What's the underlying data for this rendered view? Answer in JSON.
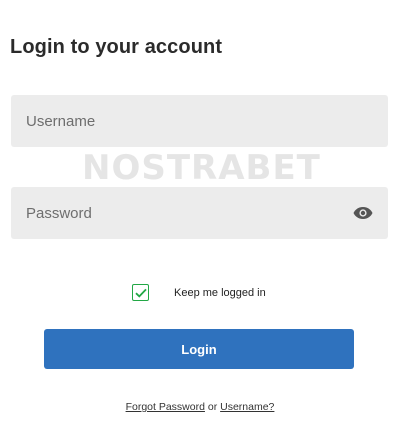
{
  "header": {
    "title": "Login to your account"
  },
  "form": {
    "username_placeholder": "Username",
    "password_placeholder": "Password",
    "password_toggle_icon": "eye-icon",
    "remember_me_label": "Keep me logged in",
    "remember_me_checked": true,
    "login_button_label": "Login"
  },
  "footer": {
    "forgot_password_link": "Forgot Password",
    "or_text": " or ",
    "username_link": "Username?"
  },
  "watermark": {
    "text": "NOSTRABET"
  },
  "colors": {
    "button": "#2f72be",
    "checkbox": "#22a745",
    "field_background": "#ececec"
  }
}
